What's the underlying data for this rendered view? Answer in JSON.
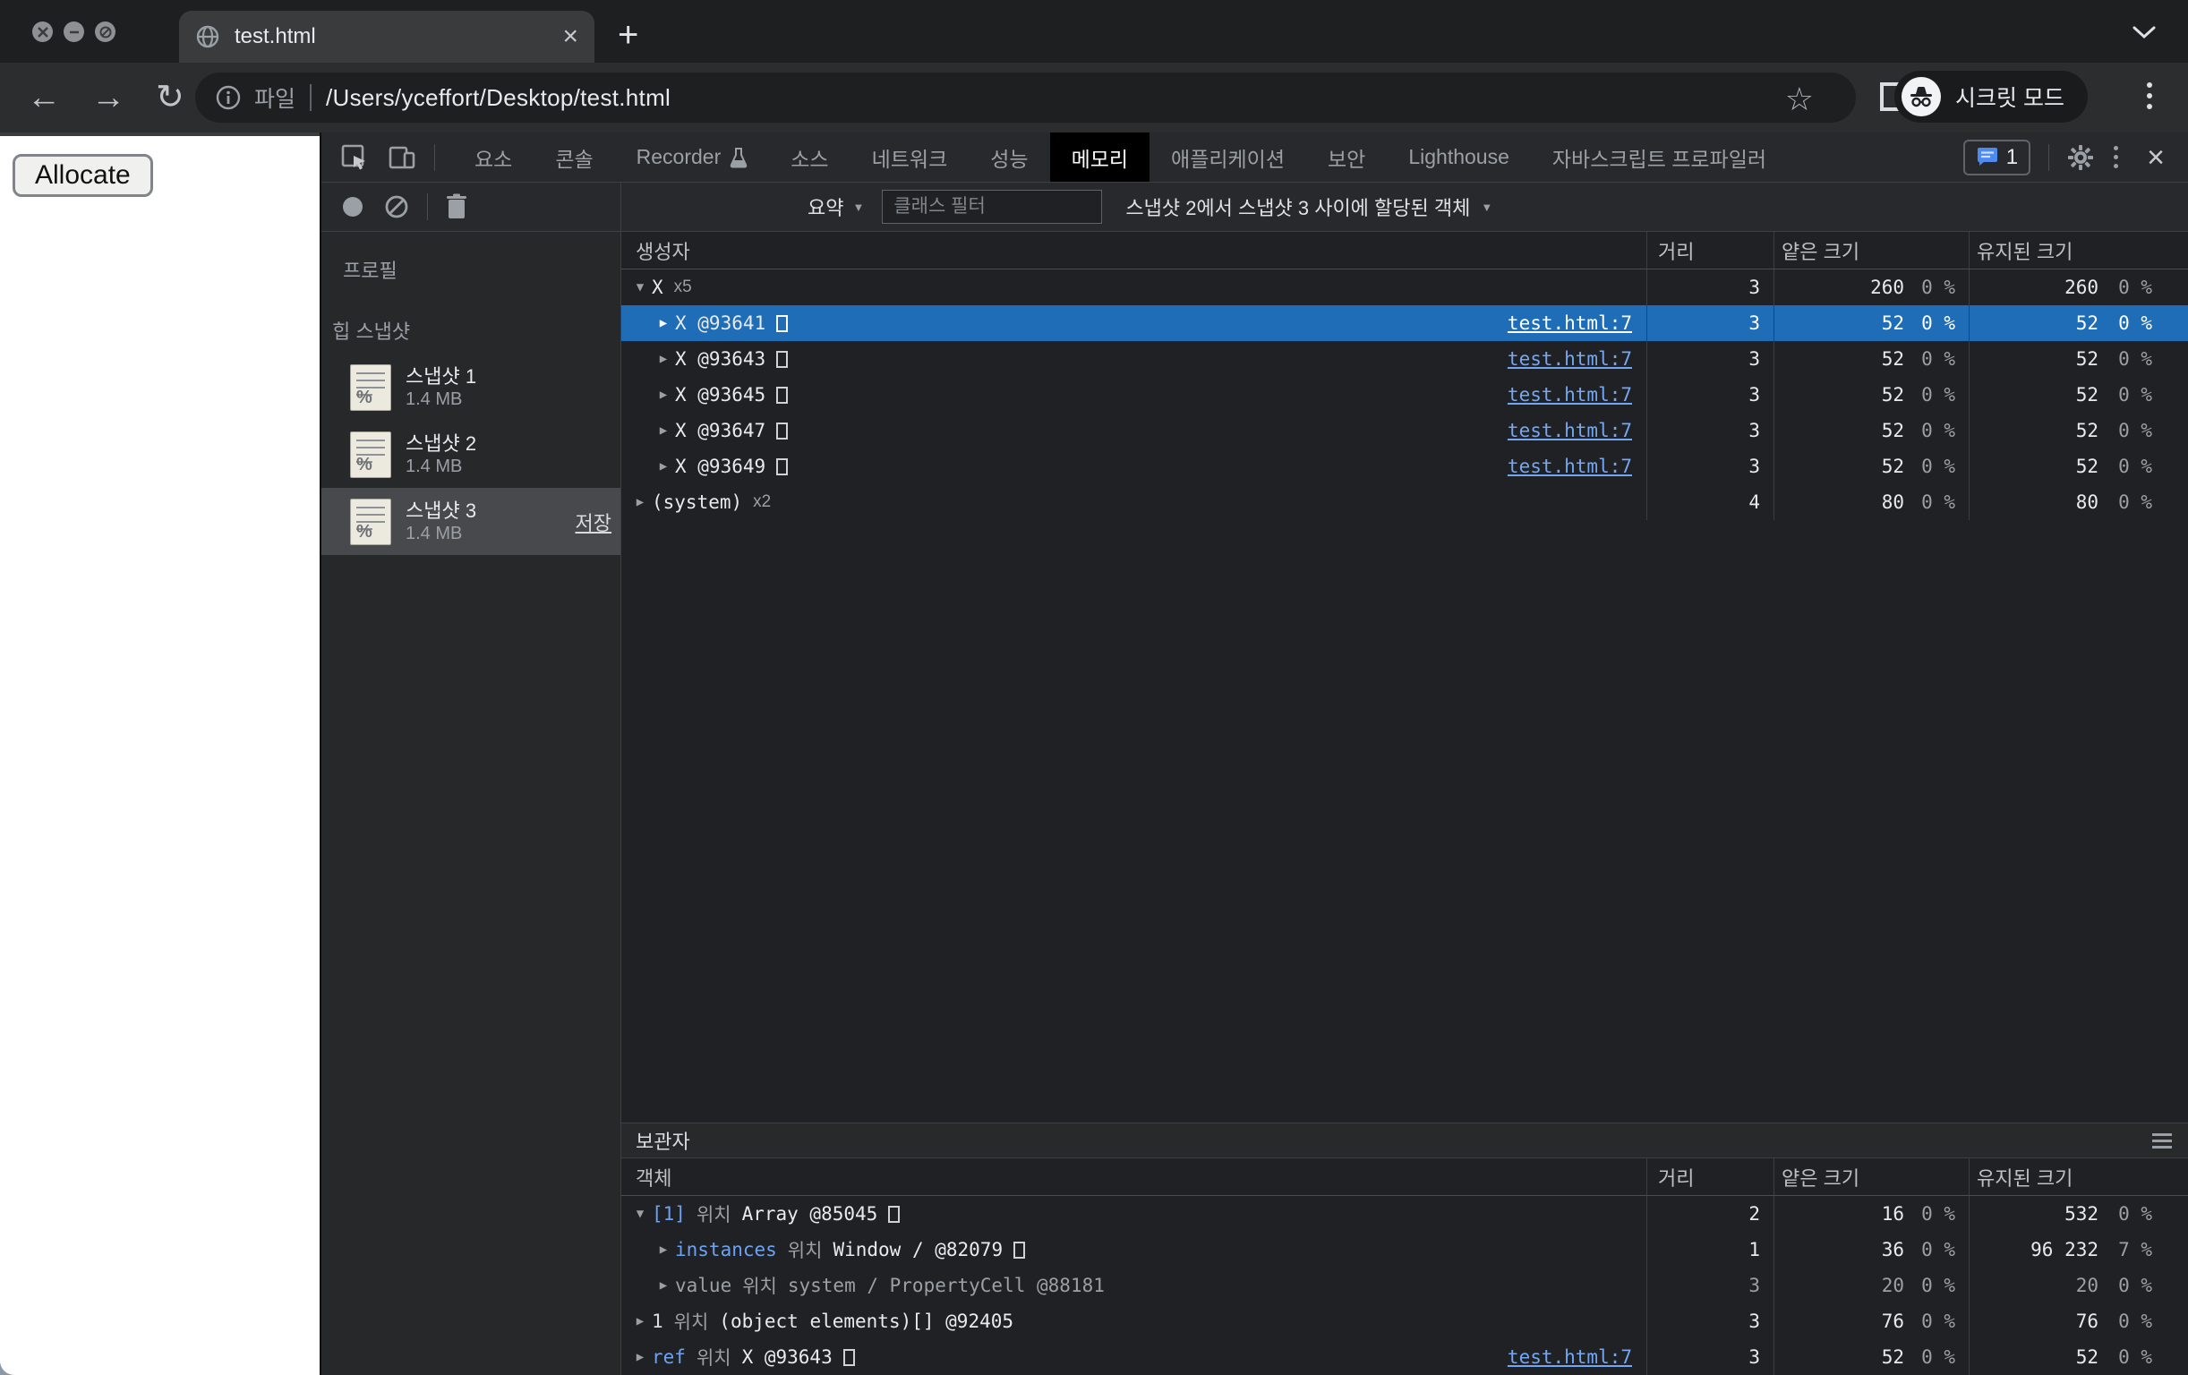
{
  "colors": {
    "selection_blue": "#1e6db6",
    "link_blue": "#74a7f2",
    "property_blue": "#6ea2f0",
    "devtools_bg": "#202124",
    "toolbar_bg": "#28292c"
  },
  "browser": {
    "tab": {
      "title": "test.html"
    },
    "new_tab_glyph": "+",
    "url": {
      "scheme_label": "파일",
      "path": "/Users/yceffort/Desktop/test.html"
    },
    "incognito_label": "시크릿 모드"
  },
  "page": {
    "allocate_label": "Allocate"
  },
  "devtools": {
    "tabs": [
      {
        "label": "요소"
      },
      {
        "label": "콘솔"
      },
      {
        "label": "Recorder",
        "flask": true
      },
      {
        "label": "소스"
      },
      {
        "label": "네트워크"
      },
      {
        "label": "성능"
      },
      {
        "label": "메모리",
        "selected": true
      },
      {
        "label": "애플리케이션"
      },
      {
        "label": "보안"
      },
      {
        "label": "Lighthouse"
      },
      {
        "label": "자바스크립트 프로파일러"
      }
    ],
    "issues_count": "1",
    "toolbar": {
      "summary_label": "요약",
      "filter_placeholder": "클래스 필터",
      "baseline_label": "스냅샷 2에서 스냅샷 3 사이에 할당된 객체"
    },
    "sidebar": {
      "profiles_label": "프로필",
      "section_label": "힙 스냅샷",
      "icon_glyph": "%",
      "items": [
        {
          "title": "스냅샷 1",
          "size": "1.4 MB",
          "selected": false
        },
        {
          "title": "스냅샷 2",
          "size": "1.4 MB",
          "selected": false
        },
        {
          "title": "스냅샷 3",
          "size": "1.4 MB",
          "selected": true,
          "save_label": "저장"
        }
      ]
    },
    "grid": {
      "headers": {
        "constructor": "생성자",
        "distance": "거리",
        "shallow": "얕은 크기",
        "retained": "유지된 크기"
      },
      "rows": [
        {
          "level": 0,
          "arrow": "▼",
          "name": "X",
          "count": "x5",
          "box": false,
          "link": "",
          "selected": false,
          "d": "3",
          "s": "260",
          "sp": "0 %",
          "r": "260",
          "rp": "0 %"
        },
        {
          "level": 1,
          "arrow": "▶",
          "name": "X @93641",
          "count": "",
          "box": true,
          "link": "test.html:7",
          "selected": true,
          "d": "3",
          "s": "52",
          "sp": "0 %",
          "r": "52",
          "rp": "0 %"
        },
        {
          "level": 1,
          "arrow": "▶",
          "name": "X @93643",
          "count": "",
          "box": true,
          "link": "test.html:7",
          "selected": false,
          "d": "3",
          "s": "52",
          "sp": "0 %",
          "r": "52",
          "rp": "0 %"
        },
        {
          "level": 1,
          "arrow": "▶",
          "name": "X @93645",
          "count": "",
          "box": true,
          "link": "test.html:7",
          "selected": false,
          "d": "3",
          "s": "52",
          "sp": "0 %",
          "r": "52",
          "rp": "0 %"
        },
        {
          "level": 1,
          "arrow": "▶",
          "name": "X @93647",
          "count": "",
          "box": true,
          "link": "test.html:7",
          "selected": false,
          "d": "3",
          "s": "52",
          "sp": "0 %",
          "r": "52",
          "rp": "0 %"
        },
        {
          "level": 1,
          "arrow": "▶",
          "name": "X @93649",
          "count": "",
          "box": true,
          "link": "test.html:7",
          "selected": false,
          "d": "3",
          "s": "52",
          "sp": "0 %",
          "r": "52",
          "rp": "0 %"
        },
        {
          "level": 0,
          "arrow": "▶",
          "name": "(system)",
          "count": "x2",
          "box": false,
          "link": "",
          "selected": false,
          "d": "4",
          "s": "80",
          "sp": "0 %",
          "r": "80",
          "rp": "0 %"
        }
      ]
    },
    "retainers": {
      "title": "보관자",
      "object_header": "객체",
      "headers": {
        "distance": "거리",
        "shallow": "얕은 크기",
        "retained": "유지된 크기"
      },
      "rows": [
        {
          "level": 0,
          "arrow": "▼",
          "dim": false,
          "box": true,
          "link": "",
          "parts": [
            {
              "t": "[1]",
              "c": "blue"
            },
            {
              "t": "위치",
              "c": "dim"
            },
            {
              "t": "Array @85045",
              "c": "obj"
            }
          ],
          "d": "2",
          "s": "16",
          "sp": "0 %",
          "r": "532",
          "rp": "0 %"
        },
        {
          "level": 1,
          "arrow": "▶",
          "dim": false,
          "box": true,
          "link": "",
          "parts": [
            {
              "t": "instances",
              "c": "blue"
            },
            {
              "t": "위치",
              "c": "dim"
            },
            {
              "t": "Window /  @82079",
              "c": "obj"
            }
          ],
          "d": "1",
          "s": "36",
          "sp": "0 %",
          "r": "96 232",
          "rp": "7 %"
        },
        {
          "level": 1,
          "arrow": "▶",
          "dim": true,
          "box": false,
          "link": "",
          "parts": [
            {
              "t": "value",
              "c": "plain"
            },
            {
              "t": "위치",
              "c": "dim"
            },
            {
              "t": "system / PropertyCell @88181",
              "c": "obj"
            }
          ],
          "d": "3",
          "s": "20",
          "sp": "0 %",
          "r": "20",
          "rp": "0 %"
        },
        {
          "level": 0,
          "arrow": "▶",
          "dim": false,
          "box": false,
          "link": "",
          "parts": [
            {
              "t": "1",
              "c": "plain"
            },
            {
              "t": "위치",
              "c": "dim"
            },
            {
              "t": "(object elements)[] @92405",
              "c": "obj"
            }
          ],
          "d": "3",
          "s": "76",
          "sp": "0 %",
          "r": "76",
          "rp": "0 %"
        },
        {
          "level": 0,
          "arrow": "▶",
          "dim": false,
          "box": true,
          "link": "test.html:7",
          "parts": [
            {
              "t": "ref",
              "c": "blue"
            },
            {
              "t": "위치",
              "c": "dim"
            },
            {
              "t": "X @93643",
              "c": "obj"
            }
          ],
          "d": "3",
          "s": "52",
          "sp": "0 %",
          "r": "52",
          "rp": "0 %"
        }
      ]
    }
  }
}
